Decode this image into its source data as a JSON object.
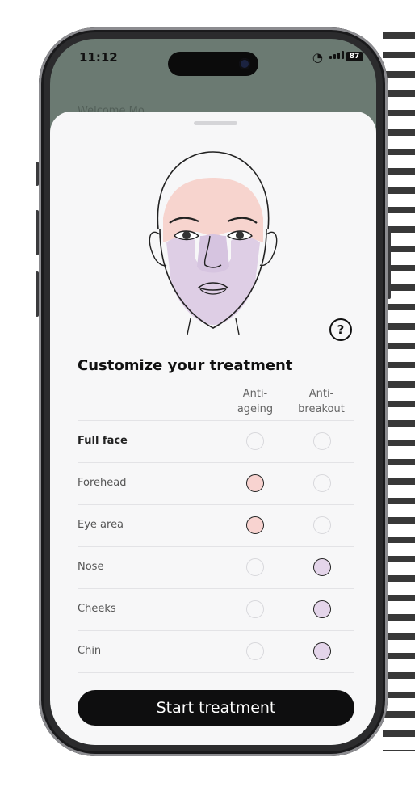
{
  "status_bar": {
    "time": "11:12",
    "battery": "87"
  },
  "behind_text": "Welcome Mo...",
  "sheet": {
    "title": "Customize your treatment",
    "help_icon_label": "?",
    "columns": [
      "Anti-\nageing",
      "Anti-\nbreakout"
    ],
    "rows": [
      {
        "label": "Full face",
        "bold": true,
        "anti_ageing": false,
        "anti_breakout": false
      },
      {
        "label": "Forehead",
        "bold": false,
        "anti_ageing": true,
        "anti_breakout": false
      },
      {
        "label": "Eye area",
        "bold": false,
        "anti_ageing": true,
        "anti_breakout": false
      },
      {
        "label": "Nose",
        "bold": false,
        "anti_ageing": false,
        "anti_breakout": true
      },
      {
        "label": "Cheeks",
        "bold": false,
        "anti_ageing": false,
        "anti_breakout": true
      },
      {
        "label": "Chin",
        "bold": false,
        "anti_ageing": false,
        "anti_breakout": true
      }
    ],
    "cta": "Start treatment"
  },
  "colors": {
    "anti_ageing_fill": "#f8d3d0",
    "anti_breakout_fill": "#e4d5ea",
    "cta_bg": "#0e0e0f"
  }
}
